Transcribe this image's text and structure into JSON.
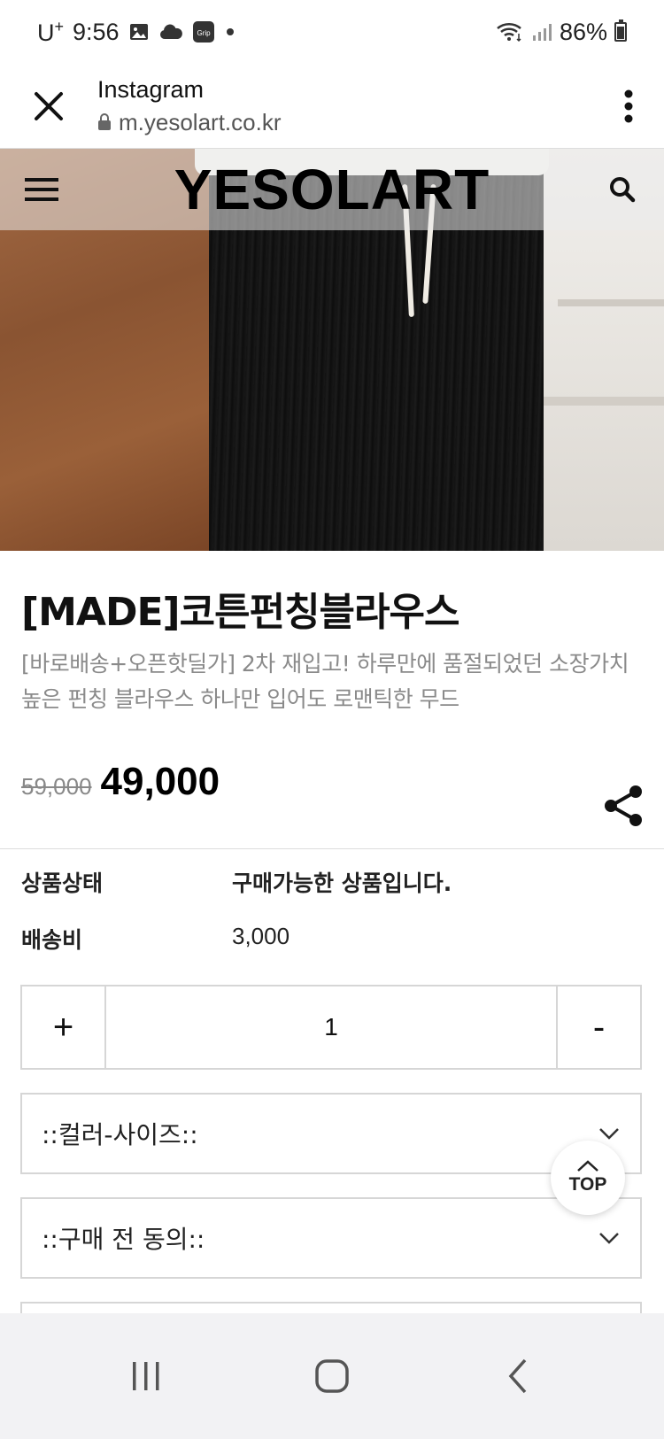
{
  "status_bar": {
    "carrier": "U",
    "carrier_sup": "+",
    "time": "9:56",
    "battery": "86%",
    "icons": [
      "gallery-icon",
      "cloud-icon",
      "grip-icon",
      "dot-icon",
      "wifi-icon",
      "signal-icon",
      "battery-icon"
    ],
    "grip_label": "Grip"
  },
  "browser": {
    "title": "Instagram",
    "url": "m.yesolart.co.kr"
  },
  "site": {
    "logo": "YESOLART"
  },
  "product": {
    "title": "[MADE]코튼펀칭블라우스",
    "description": "[바로배송+오픈핫딜가] 2차 재입고! 하루만에 품절되었던 소장가치 높은 펀칭 블라우스 하나만 입어도 로맨틱한 무드",
    "old_price": "59,000",
    "price": "49,000"
  },
  "info": {
    "status_label": "상품상태",
    "status_value": "구매가능한 상품입니다.",
    "shipping_label": "배송비",
    "shipping_value": "3,000"
  },
  "quantity": {
    "plus": "+",
    "value": "1",
    "minus": "-"
  },
  "options": {
    "color_size": "::컬러-사이즈::",
    "agreement": "::구매 전 동의::"
  },
  "top_button": {
    "label": "TOP"
  },
  "colors": {
    "accent": "#000000",
    "muted_text": "#8a8a8a",
    "border": "#d6d6d6",
    "nav_bg": "#f2f2f4"
  }
}
